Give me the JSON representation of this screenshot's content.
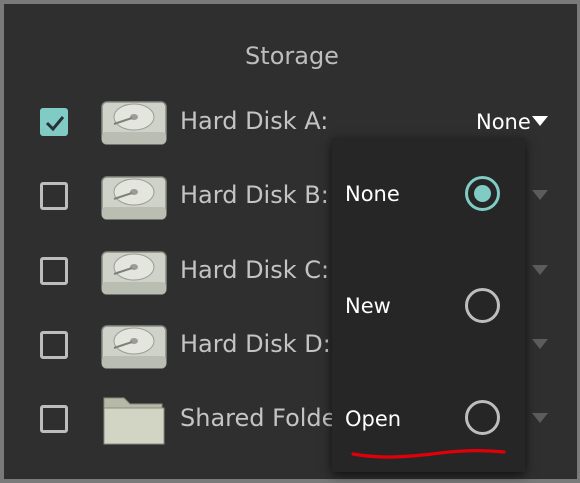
{
  "storage": {
    "title": "Storage",
    "rows": [
      {
        "label": "Hard Disk A:",
        "checked": true,
        "icon": "hard-disk-icon",
        "value": "None"
      },
      {
        "label": "Hard Disk B:",
        "checked": false,
        "icon": "hard-disk-icon"
      },
      {
        "label": "Hard Disk C:",
        "checked": false,
        "icon": "hard-disk-icon"
      },
      {
        "label": "Hard Disk D:",
        "checked": false,
        "icon": "hard-disk-icon"
      },
      {
        "label": "Shared Folde",
        "checked": false,
        "icon": "folder-icon"
      }
    ]
  },
  "dropdown": {
    "options": [
      {
        "label": "None",
        "selected": true
      },
      {
        "label": "New",
        "selected": false
      },
      {
        "label": "Open",
        "selected": false
      }
    ]
  },
  "colors": {
    "accent": "#80cbc4",
    "background": "#2f2f2f",
    "annotation": "#e0000a"
  }
}
